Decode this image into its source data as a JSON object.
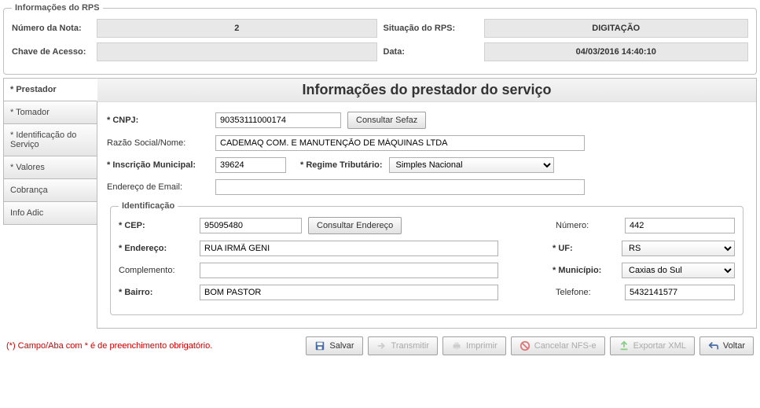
{
  "rps": {
    "legend": "Informações do RPS",
    "numero_label": "Número da Nota:",
    "numero_value": "2",
    "situacao_label": "Situação do RPS:",
    "situacao_value": "DIGITAÇÃO",
    "chave_label": "Chave de Acesso:",
    "chave_value": "",
    "data_label": "Data:",
    "data_value": "04/03/2016 14:40:10"
  },
  "tabs": {
    "prestador": "* Prestador",
    "tomador": "* Tomador",
    "identificacao": "* Identificação do Serviço",
    "valores": "* Valores",
    "cobranca": "Cobrança",
    "infoadic": "Info Adic"
  },
  "panel": {
    "title": "Informações do prestador do serviço",
    "cnpj_label": "* CNPJ:",
    "cnpj_value": "90353111000174",
    "consultar_sefaz": "Consultar Sefaz",
    "razao_label": "Razão Social/Nome:",
    "razao_value": "CADEMAQ COM. E MANUTENÇÃO DE MÁQUINAS LTDA",
    "inscricao_label": "* Inscrição Municipal:",
    "inscricao_value": "39624",
    "regime_label": "* Regime Tributário:",
    "regime_value": "Simples Nacional",
    "email_label": "Endereço de Email:",
    "email_value": ""
  },
  "ident": {
    "legend": "Identificação",
    "cep_label": "* CEP:",
    "cep_value": "95095480",
    "consultar_endereco": "Consultar Endereço",
    "numero_label": "Número:",
    "numero_value": "442",
    "endereco_label": "* Endereço:",
    "endereco_value": "RUA IRMÃ GENI",
    "uf_label": "* UF:",
    "uf_value": "RS",
    "complemento_label": "Complemento:",
    "complemento_value": "",
    "municipio_label": "* Município:",
    "municipio_value": "Caxias do Sul",
    "bairro_label": "* Bairro:",
    "bairro_value": "BOM PASTOR",
    "telefone_label": "Telefone:",
    "telefone_value": "5432141577"
  },
  "footer": {
    "note": "(*) Campo/Aba com * é de preenchimento obrigatório.",
    "salvar": "Salvar",
    "transmitir": "Transmitir",
    "imprimir": "Imprimir",
    "cancelar": "Cancelar NFS-e",
    "exportar": "Exportar XML",
    "voltar": "Voltar"
  }
}
